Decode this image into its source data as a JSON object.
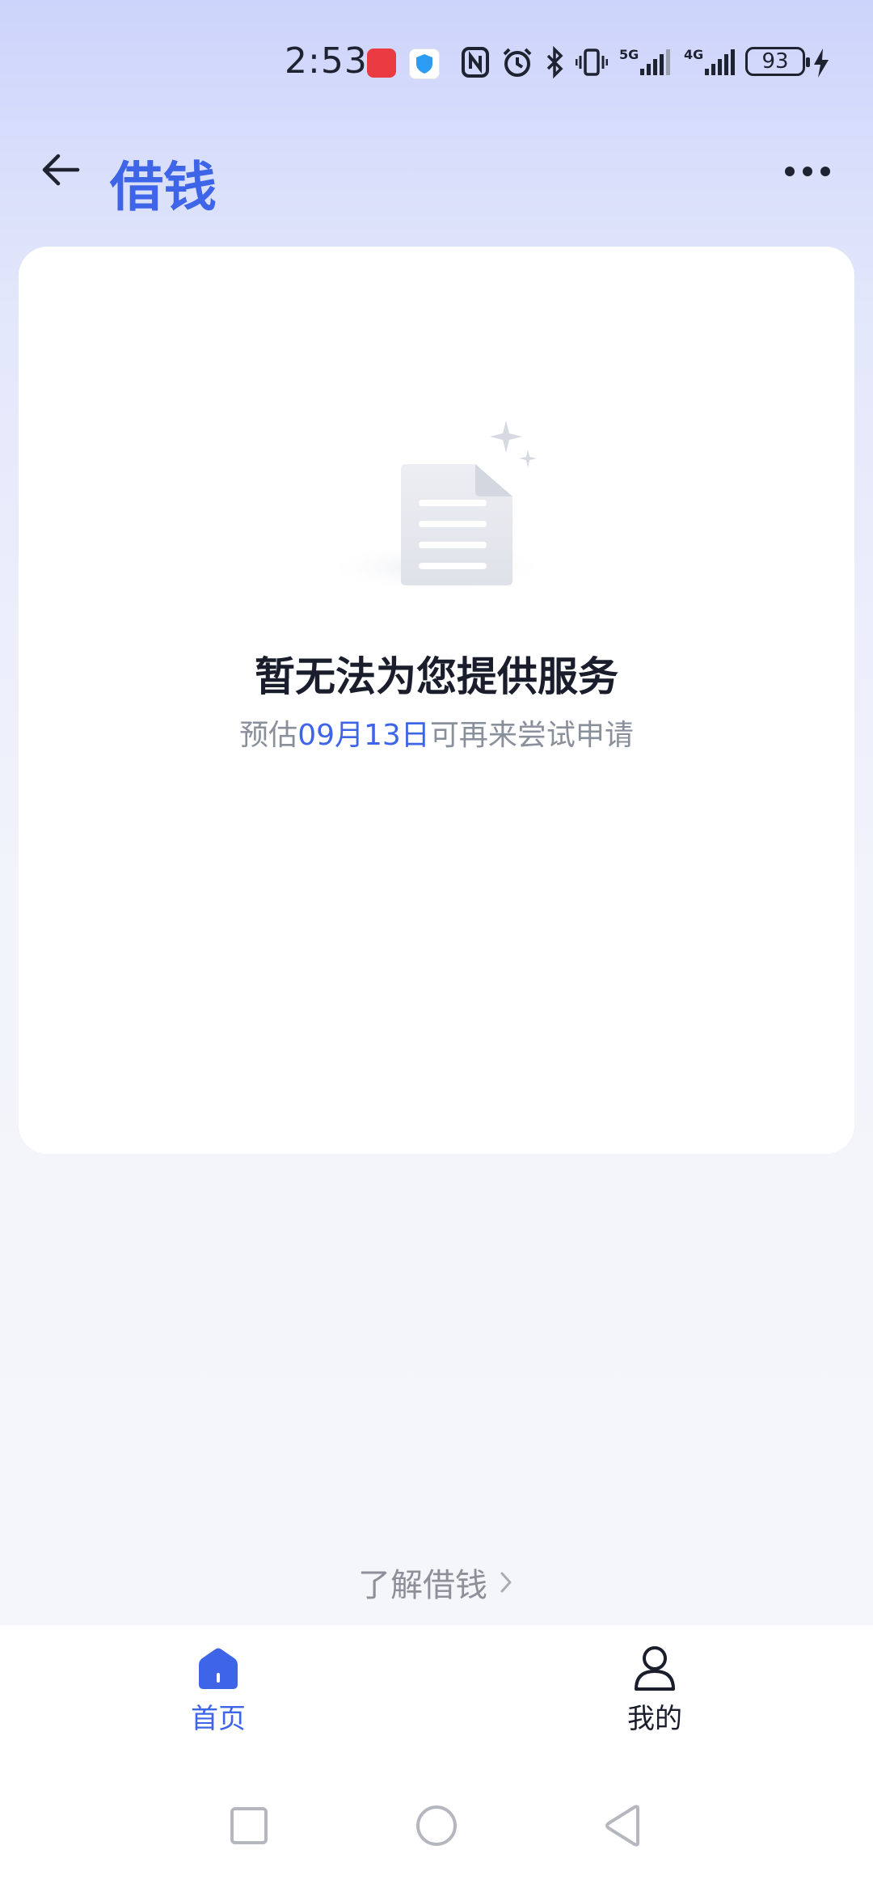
{
  "status_bar": {
    "time": "2:53",
    "battery": "93",
    "icons": [
      "huawei-store-icon",
      "shield-icon",
      "nfc-icon",
      "alarm-icon",
      "bluetooth-icon",
      "vibrate-icon",
      "signal-5g-icon",
      "signal-4g-icon",
      "charging-icon"
    ]
  },
  "app_bar": {
    "title": "借钱",
    "back_icon": "arrow-left-icon",
    "more_icon": "more-dots-icon"
  },
  "card": {
    "title": "暂无法为您提供服务",
    "subtitle_prefix": "预估",
    "subtitle_date": "09月13日",
    "subtitle_suffix": "可再来尝试申请"
  },
  "learn_link": {
    "label": "了解借钱"
  },
  "tabs": [
    {
      "label": "首页",
      "icon": "home-icon",
      "active": true
    },
    {
      "label": "我的",
      "icon": "user-icon",
      "active": false
    }
  ],
  "colors": {
    "accent": "#3e64e8",
    "title_dark": "#1a1d2b",
    "muted": "#8a8f9c"
  }
}
